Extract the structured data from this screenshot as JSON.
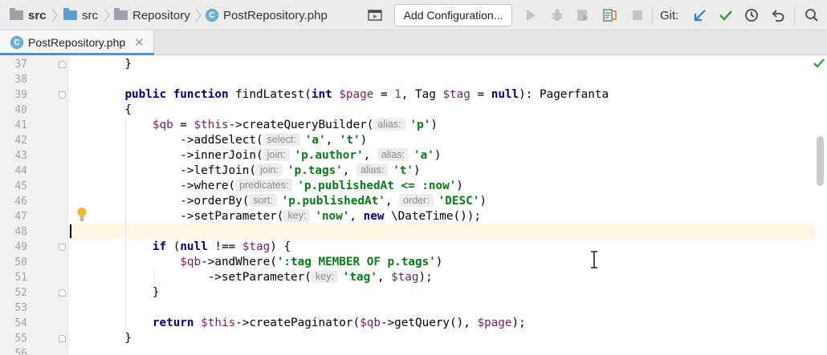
{
  "navbar": {
    "breadcrumbs": [
      {
        "label": "src",
        "icon": "folder-icon"
      },
      {
        "label": "src",
        "icon": "folder-blue-icon"
      },
      {
        "label": "Repository",
        "icon": "folder-icon"
      },
      {
        "label": "PostRepository.php",
        "icon": "php-class-icon",
        "badge": "C"
      }
    ],
    "add_configuration_label": "Add Configuration...",
    "git_label": "Git:"
  },
  "tab": {
    "label": "PostRepository.php",
    "badge": "C",
    "close": "✕"
  },
  "editor": {
    "line_numbers": [
      "37",
      "38",
      "39",
      "40",
      "41",
      "42",
      "43",
      "44",
      "45",
      "46",
      "47",
      "48",
      "49",
      "50",
      "51",
      "52",
      "53",
      "54",
      "55",
      "56"
    ],
    "current_line": "48",
    "colors": {
      "keyword": "#000080",
      "variable": "#7b1f5f",
      "string": "#067d17",
      "number": "#1750eb",
      "current_line_bg": "#fdf6e0"
    },
    "lines": [
      [
        {
          "t": "    }"
        }
      ],
      [],
      [
        {
          "t": "    "
        },
        {
          "t": "public",
          "c": "kw"
        },
        {
          "t": " "
        },
        {
          "t": "function",
          "c": "kw"
        },
        {
          "t": " findLatest("
        },
        {
          "t": "int",
          "c": "kw"
        },
        {
          "t": " "
        },
        {
          "t": "$page",
          "c": "var"
        },
        {
          "t": " = "
        },
        {
          "t": "1",
          "c": "num"
        },
        {
          "t": ", Tag "
        },
        {
          "t": "$tag",
          "c": "var"
        },
        {
          "t": " = "
        },
        {
          "t": "null",
          "c": "kw"
        },
        {
          "t": "): Pagerfanta"
        }
      ],
      [
        {
          "t": "    {"
        }
      ],
      [
        {
          "t": "        "
        },
        {
          "t": "$qb",
          "c": "var"
        },
        {
          "t": " = "
        },
        {
          "t": "$this",
          "c": "var"
        },
        {
          "t": "->createQueryBuilder("
        },
        {
          "t": "alias:",
          "c": "hint"
        },
        {
          "t": "'p'",
          "c": "str"
        },
        {
          "t": ")"
        }
      ],
      [
        {
          "t": "            ->addSelect("
        },
        {
          "t": "select:",
          "c": "hint"
        },
        {
          "t": "'a'",
          "c": "str"
        },
        {
          "t": ", "
        },
        {
          "t": "'t'",
          "c": "str"
        },
        {
          "t": ")"
        }
      ],
      [
        {
          "t": "            ->innerJoin("
        },
        {
          "t": "join:",
          "c": "hint"
        },
        {
          "t": "'p.author'",
          "c": "str"
        },
        {
          "t": ", "
        },
        {
          "t": "alias:",
          "c": "hint"
        },
        {
          "t": "'a'",
          "c": "str"
        },
        {
          "t": ")"
        }
      ],
      [
        {
          "t": "            ->leftJoin("
        },
        {
          "t": "join:",
          "c": "hint"
        },
        {
          "t": "'p.tags'",
          "c": "str"
        },
        {
          "t": ", "
        },
        {
          "t": "alias:",
          "c": "hint"
        },
        {
          "t": "'t'",
          "c": "str"
        },
        {
          "t": ")"
        }
      ],
      [
        {
          "t": "            ->where("
        },
        {
          "t": "predicates:",
          "c": "hint"
        },
        {
          "t": "'p.publishedAt <= :now'",
          "c": "str"
        },
        {
          "t": ")"
        }
      ],
      [
        {
          "t": "            ->orderBy("
        },
        {
          "t": "sort:",
          "c": "hint"
        },
        {
          "t": "'p.publishedAt'",
          "c": "str"
        },
        {
          "t": ", "
        },
        {
          "t": "order:",
          "c": "hint"
        },
        {
          "t": "'DESC'",
          "c": "str"
        },
        {
          "t": ")"
        }
      ],
      [
        {
          "t": "            ->setParameter("
        },
        {
          "t": "key:",
          "c": "hint"
        },
        {
          "t": "'now'",
          "c": "str"
        },
        {
          "t": ", "
        },
        {
          "t": "new",
          "c": "kw"
        },
        {
          "t": " \\DateTime());"
        }
      ],
      [],
      [
        {
          "t": "        "
        },
        {
          "t": "if",
          "c": "kw"
        },
        {
          "t": " ("
        },
        {
          "t": "null",
          "c": "kw"
        },
        {
          "t": " !== "
        },
        {
          "t": "$tag",
          "c": "var"
        },
        {
          "t": ") {"
        }
      ],
      [
        {
          "t": "            "
        },
        {
          "t": "$qb",
          "c": "var"
        },
        {
          "t": "->andWhere("
        },
        {
          "t": "':tag MEMBER OF p.tags'",
          "c": "str"
        },
        {
          "t": ")"
        }
      ],
      [
        {
          "t": "                ->setParameter("
        },
        {
          "t": "key:",
          "c": "hint"
        },
        {
          "t": "'tag'",
          "c": "str"
        },
        {
          "t": ", "
        },
        {
          "t": "$tag",
          "c": "var"
        },
        {
          "t": ");"
        }
      ],
      [
        {
          "t": "        }"
        }
      ],
      [],
      [
        {
          "t": "        "
        },
        {
          "t": "return",
          "c": "kw"
        },
        {
          "t": " "
        },
        {
          "t": "$this",
          "c": "var"
        },
        {
          "t": "->createPaginator("
        },
        {
          "t": "$qb",
          "c": "var"
        },
        {
          "t": "->getQuery(), "
        },
        {
          "t": "$page",
          "c": "var"
        },
        {
          "t": ");"
        }
      ],
      [
        {
          "t": "    }"
        }
      ],
      []
    ]
  }
}
